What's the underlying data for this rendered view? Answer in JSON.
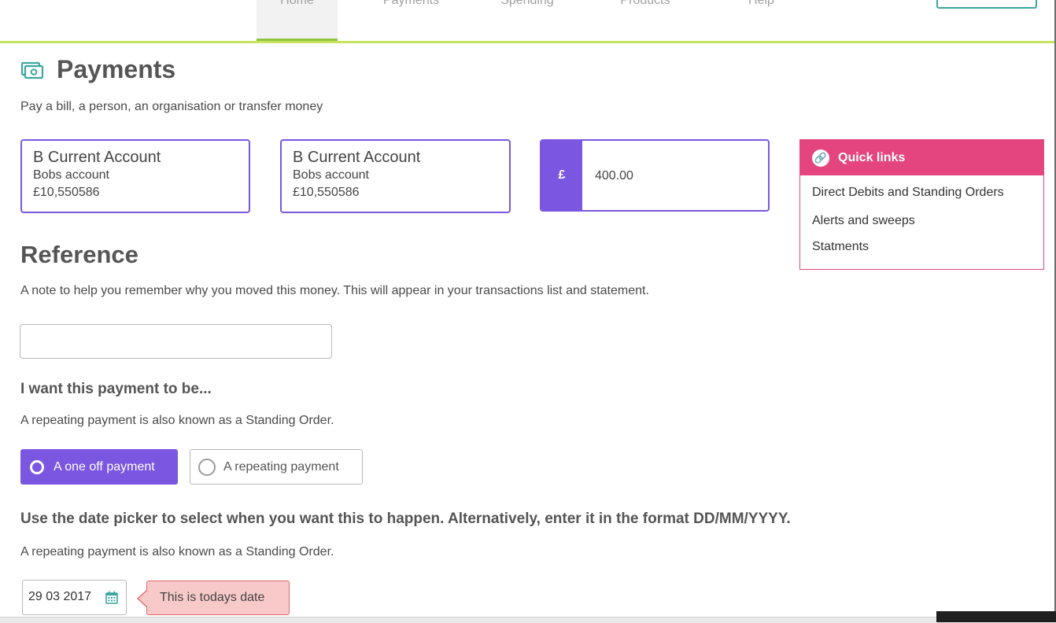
{
  "nav": {
    "items": [
      "Home",
      "Payments",
      "Spending",
      "Products",
      "Help"
    ]
  },
  "page": {
    "title": "Payments",
    "subtitle": "Pay a bill, a person, an organisation or transfer money",
    "icon": "cash-icon"
  },
  "from_account": {
    "name": "B Current Account",
    "label": "Bobs account",
    "balance": "£10,550586"
  },
  "to_account": {
    "name": "B Current Account",
    "label": "Bobs account",
    "balance": "£10,550586"
  },
  "amount": {
    "currency": "£",
    "value": "400.00"
  },
  "quick_links": {
    "title": "Quick links",
    "icon": "link-icon",
    "items": [
      "Direct Debits and Standing Orders",
      "Alerts and sweeps",
      "Statments"
    ]
  },
  "reference": {
    "heading": "Reference",
    "help": "A note to help you remember why you moved this money. This will appear in your transactions list and statement.",
    "value": ""
  },
  "payment_type": {
    "heading": "I want this payment to be...",
    "help": "A repeating payment is also known as a Standing Order.",
    "options": [
      "A one off payment",
      "A repeating payment"
    ],
    "selected": "A one off payment"
  },
  "date": {
    "heading": "Use the date picker to select when you want this to happen. Alternatively, enter it in the format DD/MM/YYYY.",
    "help": "A repeating payment is also known as a Standing Order.",
    "value": "29 03 2017",
    "tooltip": "This is todays date",
    "icon": "calendar-icon"
  },
  "colors": {
    "accent": "#7b56e0",
    "quick_links": "#e4457e",
    "nav_underline": "#c4e35f",
    "tooltip_bg": "#f8c9c9"
  }
}
